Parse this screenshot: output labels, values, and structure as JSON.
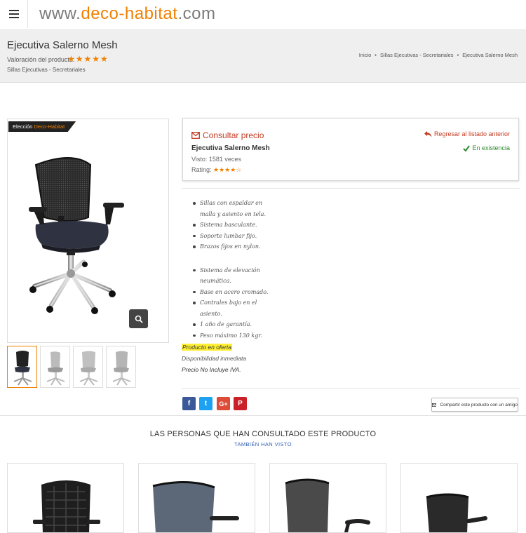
{
  "header": {
    "logo_prefix": "www.",
    "logo_brand": "deco",
    "logo_dash": "-",
    "logo_name": "habitat",
    "logo_suffix": ".com",
    "menu_icon": "hamburger-icon"
  },
  "hero": {
    "title": "Ejecutiva Salerno Mesh",
    "rating_label": "Valoración del producto:",
    "rating_stars": "★★★★★",
    "category": "Sillas Ejecutivas - Secretariales",
    "breadcrumb": [
      "Inicio",
      "Sillas Ejecutivas - Secretariales",
      "Ejecutiva Salerno Mesh"
    ],
    "breadcrumb_sep": "•"
  },
  "product_image": {
    "badge_prefix": "Elección ",
    "badge_brand": "Deco-Habitat",
    "zoom_icon": "search-icon"
  },
  "info": {
    "consult_label": "Consultar precio",
    "product_name": "Ejecutiva Salerno Mesh",
    "views": "Visto: 1581 veces",
    "rating_label": "Rating:",
    "rating_stars": "★★★★☆",
    "back_label": "Regresar al listado anterior",
    "stock_label": "En existencia"
  },
  "features": {
    "group1": [
      "Sillas con espaldar en malla y asiento en tela.",
      "Sistema basculante.",
      "Soporte lumbar fijo.",
      "Brazos fijos en nylon."
    ],
    "group2": [
      "Sistema de elevación neumática.",
      "Base en acero cromado.",
      "Contrales bajo en el asiento.",
      "1 año de garantía.",
      "Peso máximo 130 kgr."
    ]
  },
  "availability": {
    "offer": "Producto en oferta",
    "disponibility": "Disponibilidad inmediata",
    "iva": "Precio No Incluye IVA."
  },
  "share": {
    "facebook": "f",
    "twitter": "t",
    "googleplus": "G+",
    "pinterest": "P",
    "share_friend": "Compartir este producto con un amigo"
  },
  "related": {
    "title": "LAS PERSONAS QUE HAN CONSULTADO ESTE PRODUCTO",
    "subtitle": "TAMBIÉN HAN VISTO"
  },
  "colors": {
    "accent": "#f08000",
    "link_red": "#c23b22",
    "stock_green": "#2d8a2d",
    "facebook": "#3b5998",
    "twitter": "#1da1f2",
    "googleplus": "#dd4b39",
    "pinterest": "#cb2027"
  }
}
